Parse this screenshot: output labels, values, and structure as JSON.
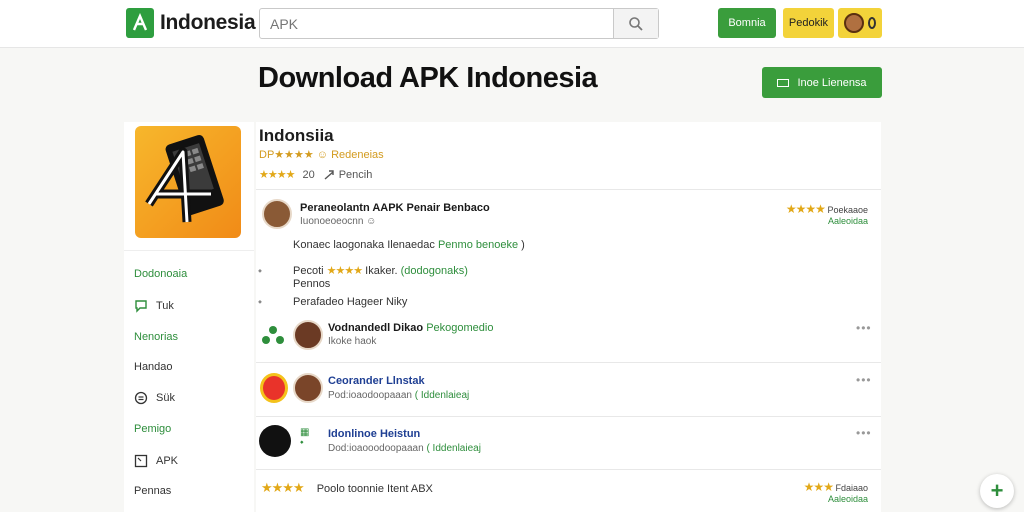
{
  "header": {
    "logo_text": "Indonesia",
    "search_placeholder": "APK",
    "btn_green": "Bomnia",
    "btn_yellow": "Pedokik"
  },
  "page": {
    "title": "Download APK Indonesia",
    "action_button": "Inoe Lienensa"
  },
  "app": {
    "name": "Indonsiia",
    "subline": "DP★★★★ ☺ Redeneias",
    "rating_stars": "★★★★",
    "rating_count": "20",
    "share_label": "Pencih"
  },
  "sidebar": {
    "items": [
      {
        "label": "Dodonoaia",
        "icon": "none",
        "green": true
      },
      {
        "label": "Tuk",
        "icon": "chat-icon",
        "green": false
      },
      {
        "label": "Nenorias",
        "icon": "none",
        "green": true
      },
      {
        "label": "Handao",
        "icon": "none",
        "green": false
      },
      {
        "label": "Sük",
        "icon": "info-icon",
        "green": false
      },
      {
        "label": "Pemigo",
        "icon": "none",
        "green": true
      },
      {
        "label": "APK",
        "icon": "square-icon",
        "green": false
      },
      {
        "label": "Pennas",
        "icon": "none",
        "green": false
      }
    ]
  },
  "featured_review": {
    "name": "Peraneolantn AAPK Penair Benbaco",
    "sub": "Iuonoeoeocnn ☺",
    "stars": "★★★★",
    "right_top": "Poekaaoe",
    "right_bottom": "Aaleoidaa",
    "body": "Konaec laogonaka Ilenaedac",
    "body_green": "Penmo benoeke",
    "body_end": ")",
    "line2_prefix": "Pecoti",
    "line2_stars": "★★★★",
    "line2_mid": "Ikaker.",
    "line2_green": "(dodogonaks)",
    "line3": "Pennos",
    "line4": "Perafadeo Hageer Niky"
  },
  "reviews": [
    {
      "name": "Vodnandedl Dikao",
      "name_green": "Pekogomedio",
      "sub": "Ikoke haok",
      "sub_green": ""
    },
    {
      "name": "Ceorander Llnstak",
      "name_green": "",
      "sub": "Pod:ioaodoopaaan",
      "sub_green": "( Iddenlaieaj"
    },
    {
      "name": "Idonlinoe Heistun",
      "name_green": "",
      "sub": "Dod:ioaooodoopaaan",
      "sub_green": "( Iddenlaieaj"
    }
  ],
  "footer_review": {
    "stars": "★★★★",
    "text": "Poolo toonnie Itent ABX",
    "right_stars": "★★★",
    "right_top": "Fdaiaao",
    "right_bottom": "Aaleoidaa"
  },
  "colors": {
    "accent_green": "#3a9d3c",
    "accent_yellow": "#f3d33a",
    "star_gold": "#e2a818"
  }
}
